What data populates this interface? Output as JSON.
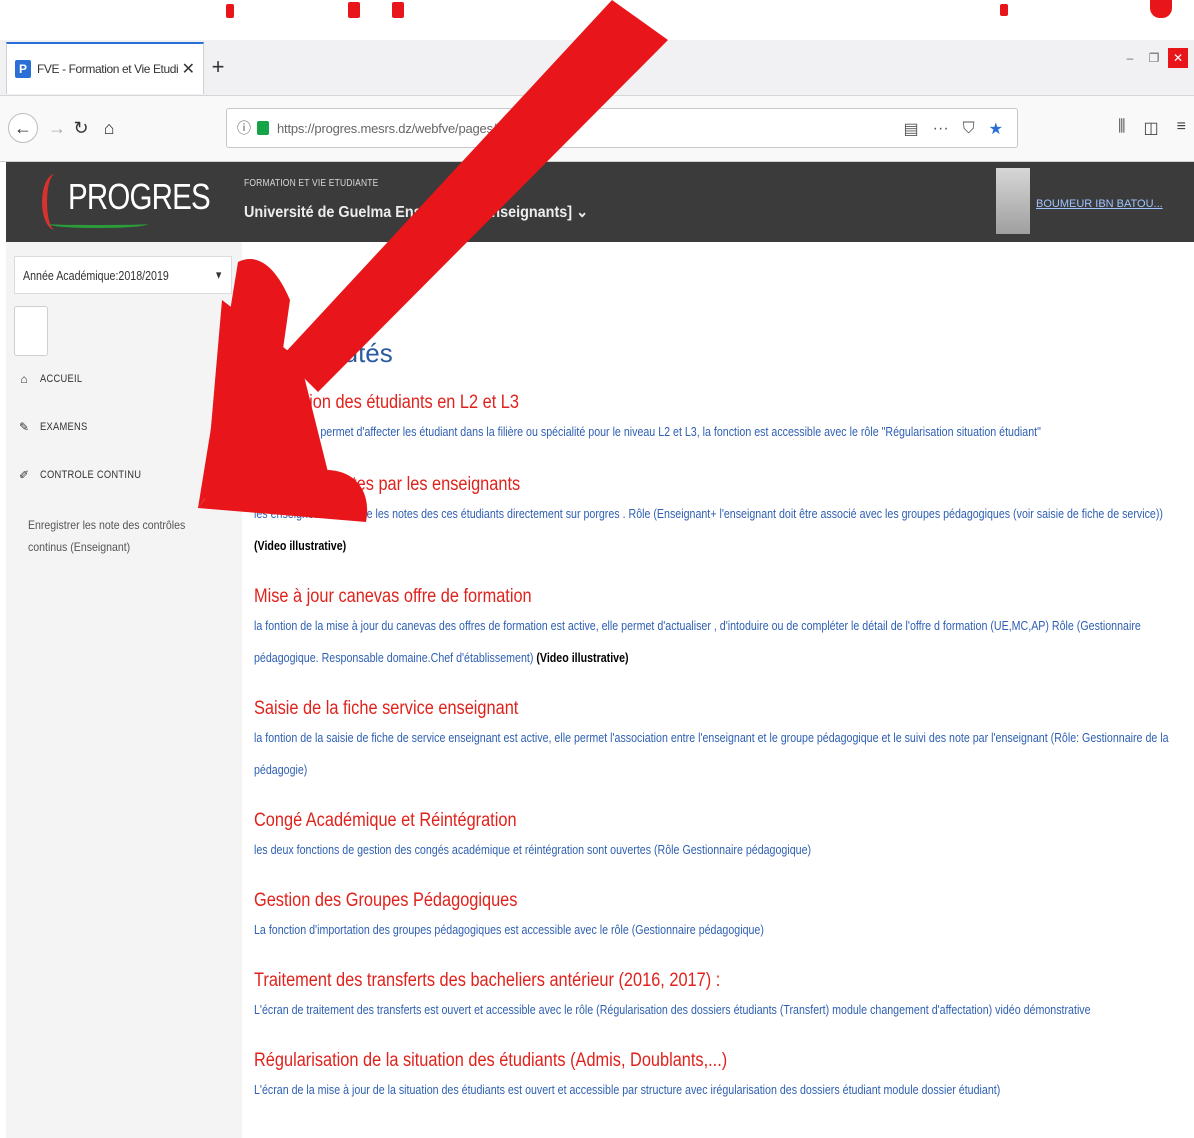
{
  "browser": {
    "tab_title": "FVE - Formation et Vie Etudian",
    "favicon_letter": "P",
    "url": "https://progres.mesrs.dz/webfve/pages/index.xh"
  },
  "header": {
    "logo_text": "PROGRES",
    "subtitle": "FORMATION ET VIE ETUDIANTE",
    "title": "Université de Guelma Enseignant   [Enseignants] ⌄",
    "user_name": "BOUMEUR IBN BATOU..."
  },
  "sidebar": {
    "year_label": "Année Académique:2018/2019",
    "menu": [
      {
        "icon": "home-icon",
        "label": "ACCUEIL"
      },
      {
        "icon": "pencil-icon",
        "label": "EXAMENS"
      },
      {
        "icon": "edit-icon",
        "label": "CONTROLE CONTINU"
      }
    ],
    "submenu_item": "Enregistrer les note des contrôles continus (Enseignant)"
  },
  "content": {
    "title": "Nouveautés",
    "news": [
      {
        "title": "Affectation des étudiants en L2 et L3",
        "desc": "cette fonction permet d'affecter les étudiant dans la filière ou spécialité pour le niveau L2 et L3, la fonction est accessible avec le rôle \"Régularisation situation étudiant\""
      },
      {
        "title": "Saisie des notes par les enseignants",
        "desc": "les enseigneux introduire les notes des ces étudiants directement sur porgres . Rôle (Enseignant+ l'enseignant doit être associé avec les groupes pédagogiques (voir saisie de fiche de service))",
        "extra": "(Video illustrative)"
      },
      {
        "title": "Mise à jour canevas offre de formation",
        "desc": "la fontion de la mise à jour du canevas des offres de formation est active, elle permet d'actualiser , d'intoduire ou de compléter le détail de l'offre d formation (UE,MC,AP) Rôle (Gestionnaire pédagogique. Responsable domaine.Chef d'établissement)",
        "extra": "(Video illustrative)"
      },
      {
        "title": "Saisie de la fiche service enseignant",
        "desc": "la fontion de la saisie de fiche de service enseignant est active, elle permet l'association entre l'enseignant et le groupe pédagogique et le suivi des note par l'enseignant (Rôle: Gestionnaire de la pédagogie)"
      },
      {
        "title": "Congé Académique et Réintégration",
        "desc": "les deux fonctions de gestion des congés académique et réintégration sont ouvertes (Rôle Gestionnaire pédagogique)"
      },
      {
        "title": "Gestion des Groupes Pédagogiques",
        "desc": "La fonction d'importation des groupes pédagogiques est accessible avec le rôle (Gestionnaire pédagogique)"
      },
      {
        "title": "Traitement des transferts des bacheliers antérieur (2016, 2017) :",
        "desc": "L'écran de traitement des transferts est ouvert et accessible avec le rôle (Régularisation des dossiers étudiants (Transfert) module changement d'affectation) vidéo démonstrative"
      },
      {
        "title": "Régularisation de la situation des étudiants (Admis, Doublants,...)",
        "desc": "L'écran de la mise à jour de la situation des étudiants est ouvert et accessible par structure avec irégularisation des dossiers étudiant module dossier étudiant)"
      }
    ]
  },
  "colors": {
    "accent_red": "#e0221c",
    "link_blue": "#2e5fb3",
    "header_bg": "#3b3b3b",
    "arrow_red": "#e8161b"
  }
}
